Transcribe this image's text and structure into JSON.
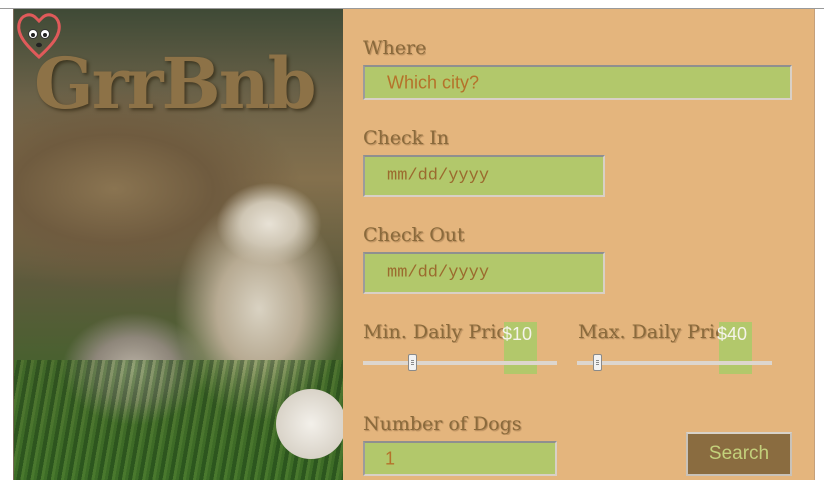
{
  "brand": {
    "name": "GrrBnb",
    "logo_icon": "dog-heart-icon"
  },
  "form": {
    "where_label": "Where",
    "where_placeholder": "Which city?",
    "checkin_label": "Check In",
    "checkin_placeholder": "mm/dd/yyyy",
    "checkout_label": "Check Out",
    "checkout_placeholder": "mm/dd/yyyy",
    "min_price_label": "Min. Daily Price",
    "min_price_value": "$10",
    "min_price_fraction": 0.25,
    "max_price_label": "Max. Daily Price",
    "max_price_value": "$40",
    "max_price_fraction": 0.1,
    "dogs_label": "Number of Dogs",
    "dogs_value": "1",
    "search_label": "Search"
  },
  "colors": {
    "panel": "#e4b57d",
    "input": "#b2c86b",
    "brand_text": "#8d7247",
    "button": "#8a6c40"
  }
}
